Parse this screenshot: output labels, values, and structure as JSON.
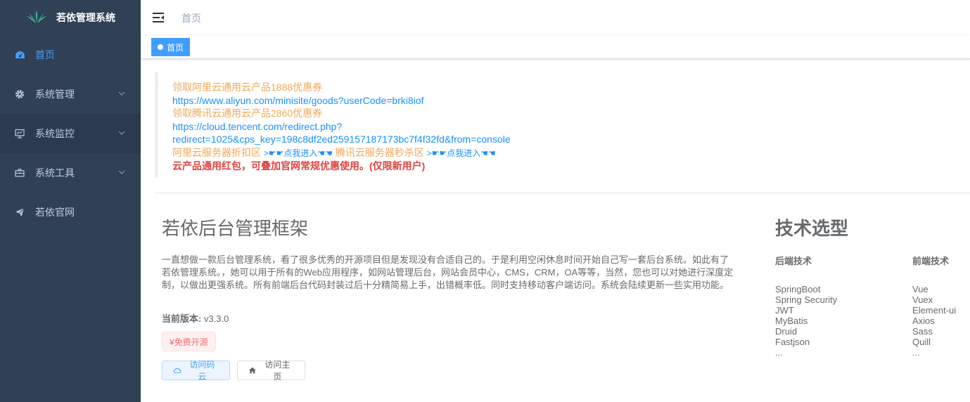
{
  "app": {
    "title": "若依管理系统"
  },
  "sidebar": {
    "items": [
      {
        "label": "首页",
        "icon": "dashboard-icon",
        "active": true
      },
      {
        "label": "系统管理",
        "icon": "gear-icon",
        "has_children": true
      },
      {
        "label": "系统监控",
        "icon": "monitor-icon",
        "has_children": true
      },
      {
        "label": "系统工具",
        "icon": "toolbox-icon",
        "has_children": true
      },
      {
        "label": "若依官网",
        "icon": "send-icon"
      }
    ]
  },
  "navbar": {
    "breadcrumb": "首页"
  },
  "tags": [
    {
      "label": "首页",
      "active": true
    }
  ],
  "notice": {
    "line1": "领取阿里云通用云产品1888优惠券",
    "link1": "https://www.aliyun.com/minisite/goods?userCode=brki8iof",
    "line2": "领取腾讯云通用云产品2860优惠券",
    "link2": "https://cloud.tencent.com/redirect.php?redirect=1025&cps_key=198c8df2ed259157187173bc7f4f32fd&from=console",
    "promo1": "阿里云服务器折扣区",
    "promo1_link": ">☛☛点我进入☚☚",
    "promo2": "腾讯云服务器秒杀区",
    "promo2_link": ">☛☛点我进入☚☚",
    "warning": "云产品通用红包，可叠加官网常规优惠使用。(仅限新用户)"
  },
  "intro": {
    "title": "若依后台管理框架",
    "description": "一直想做一款后台管理系统，看了很多优秀的开源项目但是发现没有合适自己的。于是利用空闲休息时间开始自己写一套后台系统。如此有了若依管理系统。，她可以用于所有的Web应用程序，如网站管理后台，网站会员中心，CMS，CRM，OA等等，当然，您也可以对她进行深度定制，以做出更强系统。所有前端后台代码封装过后十分精简易上手，出错概率低。同时支持移动客户端访问。系统会陆续更新一些实用功能。",
    "version_label": "当前版本:",
    "version": "v3.3.0",
    "free_tag": "¥免费开源",
    "btn_gitee": "访问码云",
    "btn_home": "访问主页"
  },
  "tech": {
    "title": "技术选型",
    "backend_title": "后端技术",
    "backend": [
      "SpringBoot",
      "Spring Security",
      "JWT",
      "MyBatis",
      "Druid",
      "Fastjson",
      "..."
    ],
    "frontend_title": "前端技术",
    "frontend": [
      "Vue",
      "Vuex",
      "Element-ui",
      "Axios",
      "Sass",
      "Quill",
      "..."
    ]
  },
  "colors": {
    "sidebar_bg": "#304156",
    "accent": "#409eff",
    "orange": "#f0a85a",
    "danger": "#e0433f"
  }
}
